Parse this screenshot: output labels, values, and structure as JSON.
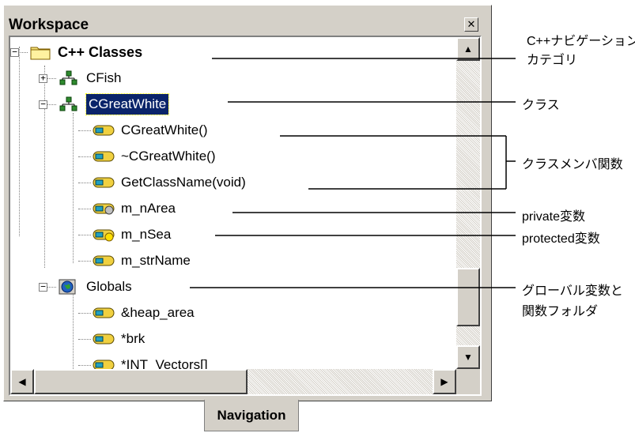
{
  "panel": {
    "title": "Workspace",
    "close_glyph": "✕"
  },
  "tree": [
    {
      "label": "C++ Classes",
      "icon": "folder-icon",
      "expander": "−",
      "bold": true
    },
    {
      "label": "CFish",
      "icon": "class-icon",
      "expander": "+"
    },
    {
      "label": "CGreatWhite",
      "icon": "class-icon",
      "expander": "−",
      "selected": true
    },
    {
      "label": "CGreatWhite()",
      "icon": "member-function-icon"
    },
    {
      "label": "~CGreatWhite()",
      "icon": "member-function-icon"
    },
    {
      "label": "GetClassName(void)",
      "icon": "member-function-icon"
    },
    {
      "label": "m_nArea",
      "icon": "private-variable-icon"
    },
    {
      "label": "m_nSea",
      "icon": "protected-variable-icon"
    },
    {
      "label": "m_strName",
      "icon": "member-variable-icon"
    },
    {
      "label": "Globals",
      "icon": "globe-icon",
      "expander": "−"
    },
    {
      "label": "&heap_area",
      "icon": "member-variable-icon"
    },
    {
      "label": "*brk",
      "icon": "member-variable-icon"
    },
    {
      "label": "*INT_Vectors[]",
      "icon": "member-variable-icon"
    }
  ],
  "scroll": {
    "up": "▲",
    "down": "▼",
    "left": "◀",
    "right": "▶"
  },
  "tab": {
    "label": "Navigation"
  },
  "annotations": {
    "nav_category_1": "C++ナビゲーション",
    "nav_category_2": "カテゴリ",
    "class": "クラス",
    "member_func": "クラスメンバ関数",
    "private_var": "private変数",
    "protected_var": "protected変数",
    "global_1": "グローバル変数と",
    "global_2": "関数フォルダ"
  }
}
